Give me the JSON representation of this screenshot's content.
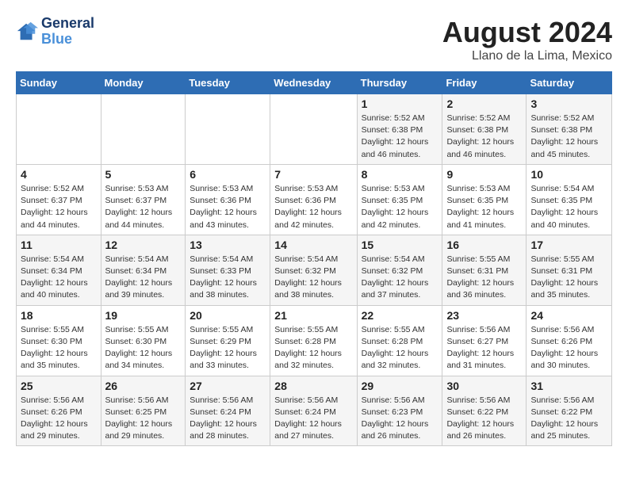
{
  "logo": {
    "line1": "General",
    "line2": "Blue"
  },
  "title": "August 2024",
  "location": "Llano de la Lima, Mexico",
  "days_of_week": [
    "Sunday",
    "Monday",
    "Tuesday",
    "Wednesday",
    "Thursday",
    "Friday",
    "Saturday"
  ],
  "weeks": [
    [
      {
        "num": "",
        "info": ""
      },
      {
        "num": "",
        "info": ""
      },
      {
        "num": "",
        "info": ""
      },
      {
        "num": "",
        "info": ""
      },
      {
        "num": "1",
        "info": "Sunrise: 5:52 AM\nSunset: 6:38 PM\nDaylight: 12 hours\nand 46 minutes."
      },
      {
        "num": "2",
        "info": "Sunrise: 5:52 AM\nSunset: 6:38 PM\nDaylight: 12 hours\nand 46 minutes."
      },
      {
        "num": "3",
        "info": "Sunrise: 5:52 AM\nSunset: 6:38 PM\nDaylight: 12 hours\nand 45 minutes."
      }
    ],
    [
      {
        "num": "4",
        "info": "Sunrise: 5:52 AM\nSunset: 6:37 PM\nDaylight: 12 hours\nand 44 minutes."
      },
      {
        "num": "5",
        "info": "Sunrise: 5:53 AM\nSunset: 6:37 PM\nDaylight: 12 hours\nand 44 minutes."
      },
      {
        "num": "6",
        "info": "Sunrise: 5:53 AM\nSunset: 6:36 PM\nDaylight: 12 hours\nand 43 minutes."
      },
      {
        "num": "7",
        "info": "Sunrise: 5:53 AM\nSunset: 6:36 PM\nDaylight: 12 hours\nand 42 minutes."
      },
      {
        "num": "8",
        "info": "Sunrise: 5:53 AM\nSunset: 6:35 PM\nDaylight: 12 hours\nand 42 minutes."
      },
      {
        "num": "9",
        "info": "Sunrise: 5:53 AM\nSunset: 6:35 PM\nDaylight: 12 hours\nand 41 minutes."
      },
      {
        "num": "10",
        "info": "Sunrise: 5:54 AM\nSunset: 6:35 PM\nDaylight: 12 hours\nand 40 minutes."
      }
    ],
    [
      {
        "num": "11",
        "info": "Sunrise: 5:54 AM\nSunset: 6:34 PM\nDaylight: 12 hours\nand 40 minutes."
      },
      {
        "num": "12",
        "info": "Sunrise: 5:54 AM\nSunset: 6:34 PM\nDaylight: 12 hours\nand 39 minutes."
      },
      {
        "num": "13",
        "info": "Sunrise: 5:54 AM\nSunset: 6:33 PM\nDaylight: 12 hours\nand 38 minutes."
      },
      {
        "num": "14",
        "info": "Sunrise: 5:54 AM\nSunset: 6:32 PM\nDaylight: 12 hours\nand 38 minutes."
      },
      {
        "num": "15",
        "info": "Sunrise: 5:54 AM\nSunset: 6:32 PM\nDaylight: 12 hours\nand 37 minutes."
      },
      {
        "num": "16",
        "info": "Sunrise: 5:55 AM\nSunset: 6:31 PM\nDaylight: 12 hours\nand 36 minutes."
      },
      {
        "num": "17",
        "info": "Sunrise: 5:55 AM\nSunset: 6:31 PM\nDaylight: 12 hours\nand 35 minutes."
      }
    ],
    [
      {
        "num": "18",
        "info": "Sunrise: 5:55 AM\nSunset: 6:30 PM\nDaylight: 12 hours\nand 35 minutes."
      },
      {
        "num": "19",
        "info": "Sunrise: 5:55 AM\nSunset: 6:30 PM\nDaylight: 12 hours\nand 34 minutes."
      },
      {
        "num": "20",
        "info": "Sunrise: 5:55 AM\nSunset: 6:29 PM\nDaylight: 12 hours\nand 33 minutes."
      },
      {
        "num": "21",
        "info": "Sunrise: 5:55 AM\nSunset: 6:28 PM\nDaylight: 12 hours\nand 32 minutes."
      },
      {
        "num": "22",
        "info": "Sunrise: 5:55 AM\nSunset: 6:28 PM\nDaylight: 12 hours\nand 32 minutes."
      },
      {
        "num": "23",
        "info": "Sunrise: 5:56 AM\nSunset: 6:27 PM\nDaylight: 12 hours\nand 31 minutes."
      },
      {
        "num": "24",
        "info": "Sunrise: 5:56 AM\nSunset: 6:26 PM\nDaylight: 12 hours\nand 30 minutes."
      }
    ],
    [
      {
        "num": "25",
        "info": "Sunrise: 5:56 AM\nSunset: 6:26 PM\nDaylight: 12 hours\nand 29 minutes."
      },
      {
        "num": "26",
        "info": "Sunrise: 5:56 AM\nSunset: 6:25 PM\nDaylight: 12 hours\nand 29 minutes."
      },
      {
        "num": "27",
        "info": "Sunrise: 5:56 AM\nSunset: 6:24 PM\nDaylight: 12 hours\nand 28 minutes."
      },
      {
        "num": "28",
        "info": "Sunrise: 5:56 AM\nSunset: 6:24 PM\nDaylight: 12 hours\nand 27 minutes."
      },
      {
        "num": "29",
        "info": "Sunrise: 5:56 AM\nSunset: 6:23 PM\nDaylight: 12 hours\nand 26 minutes."
      },
      {
        "num": "30",
        "info": "Sunrise: 5:56 AM\nSunset: 6:22 PM\nDaylight: 12 hours\nand 26 minutes."
      },
      {
        "num": "31",
        "info": "Sunrise: 5:56 AM\nSunset: 6:22 PM\nDaylight: 12 hours\nand 25 minutes."
      }
    ]
  ]
}
